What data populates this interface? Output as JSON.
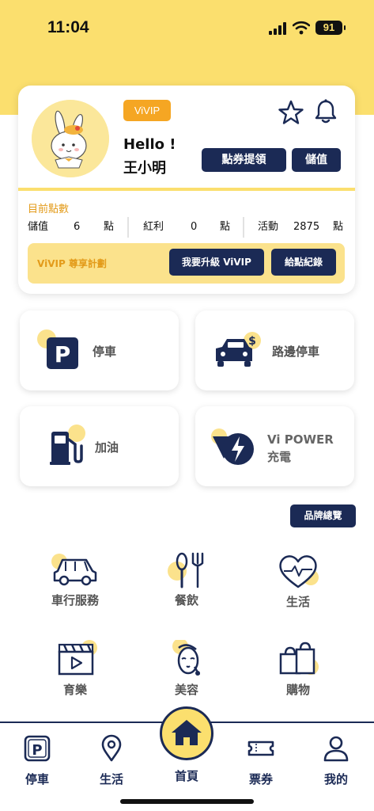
{
  "status_bar": {
    "time": "11:04",
    "battery": "91"
  },
  "member": {
    "badge": "ViVIP",
    "greeting": "Hello !",
    "name": "王小明",
    "redeem_label": "點券提領",
    "topup_label": "儲值",
    "points_title": "目前點數",
    "points": [
      {
        "label": "儲值",
        "value": "6",
        "unit": "點"
      },
      {
        "label": "紅利",
        "value": "0",
        "unit": "點"
      },
      {
        "label": "活動",
        "value": "2875",
        "unit": "點"
      }
    ],
    "vip_plan_label": "ViVIP 尊享計劃",
    "upgrade_label": "我要升級 ViVIP",
    "record_label": "給點紀錄"
  },
  "services": {
    "parking": "停車",
    "street_parking": "路邊停車",
    "fuel": "加油",
    "vipower_line1": "Vi POWER",
    "vipower_line2": "充電"
  },
  "brand_overview_label": "品牌總覽",
  "categories": [
    {
      "label": "車行服務",
      "icon": "car-icon"
    },
    {
      "label": "餐飲",
      "icon": "cutlery-icon"
    },
    {
      "label": "生活",
      "icon": "heart-pulse-icon"
    },
    {
      "label": "育樂",
      "icon": "clapperboard-icon"
    },
    {
      "label": "美容",
      "icon": "beauty-face-icon"
    },
    {
      "label": "購物",
      "icon": "shopping-bag-icon"
    }
  ],
  "bottom_nav": {
    "parking": "停車",
    "life": "生活",
    "home": "首頁",
    "tickets": "票券",
    "me": "我的"
  },
  "colors": {
    "brand_yellow": "#FBDF6E",
    "navy": "#1B2A55",
    "orange": "#F5A623"
  }
}
